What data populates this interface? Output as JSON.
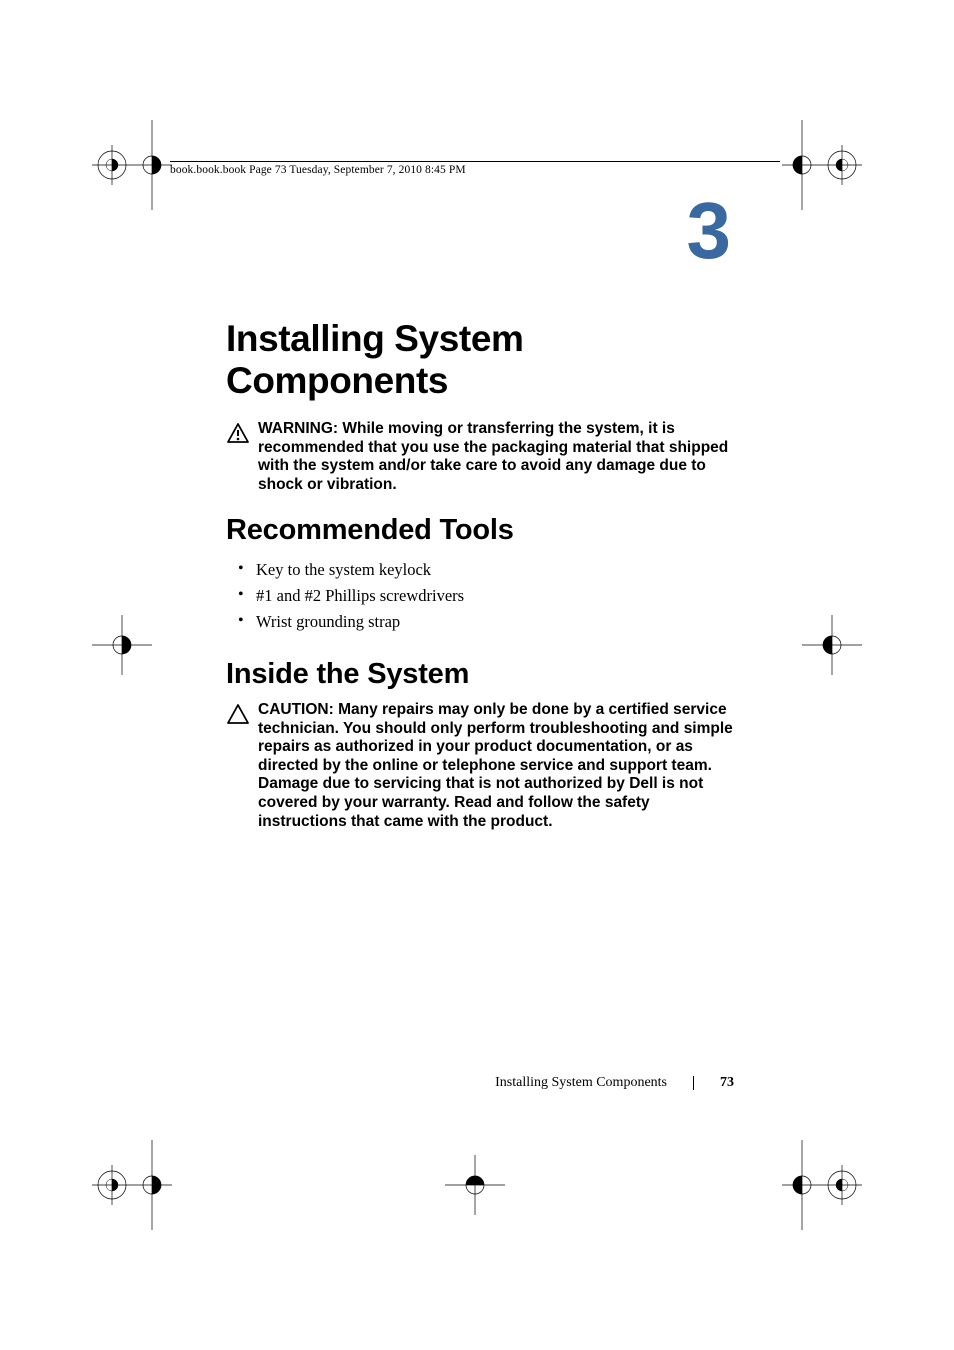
{
  "header": {
    "text": "book.book.book  Page 73  Tuesday, September 7, 2010  8:45 PM"
  },
  "chapter": {
    "number": "3",
    "title": "Installing System Components"
  },
  "warning": {
    "lead": "WARNING: ",
    "body": "While moving or transferring the system, it is recommended that you use the packaging material that shipped with the system and/or take care to avoid any damage due to shock or vibration."
  },
  "sections": {
    "tools": {
      "heading": "Recommended Tools",
      "items": [
        "Key to the system keylock",
        "#1 and #2 Phillips screwdrivers",
        "Wrist grounding strap"
      ]
    },
    "inside": {
      "heading": "Inside the System"
    }
  },
  "caution": {
    "lead": "CAUTION: ",
    "body": "Many repairs may only be done by a certified service technician. You should only perform troubleshooting and simple repairs as authorized in your product documentation, or as directed by the online or telephone service and support team. Damage due to servicing that is not authorized by Dell is not covered by your warranty. Read and follow the safety instructions that came with the product."
  },
  "footer": {
    "section": "Installing System Components",
    "page": "73"
  }
}
